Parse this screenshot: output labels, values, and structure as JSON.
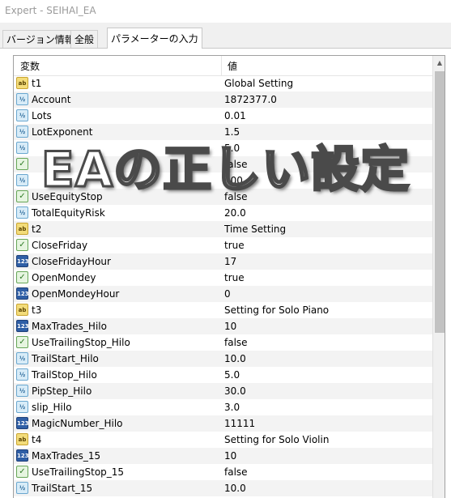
{
  "window": {
    "title": "Expert - SEIHAI_EA"
  },
  "tabs": [
    {
      "label": "バージョン情報"
    },
    {
      "label": "全般"
    },
    {
      "label": "パラメーターの入力",
      "active": true
    }
  ],
  "grid": {
    "col_name": "変数",
    "col_value": "値",
    "rows": [
      {
        "type": "ab",
        "name": "t1",
        "value": "Global Setting"
      },
      {
        "type": "dbl",
        "name": "Account",
        "value": "1872377.0"
      },
      {
        "type": "dbl",
        "name": "Lots",
        "value": "0.01"
      },
      {
        "type": "dbl",
        "name": "LotExponent",
        "value": "1.5"
      },
      {
        "type": "dbl",
        "name": "",
        "value": "5.0"
      },
      {
        "type": "bool",
        "name": "",
        "value": "false"
      },
      {
        "type": "dbl",
        "name": "",
        "value": "100"
      },
      {
        "type": "bool",
        "name": "UseEquityStop",
        "value": "false"
      },
      {
        "type": "dbl",
        "name": "TotalEquityRisk",
        "value": "20.0"
      },
      {
        "type": "ab",
        "name": "t2",
        "value": "Time Setting"
      },
      {
        "type": "bool",
        "name": "CloseFriday",
        "value": "true"
      },
      {
        "type": "int",
        "name": "CloseFridayHour",
        "value": "17"
      },
      {
        "type": "bool",
        "name": "OpenMondey",
        "value": "true"
      },
      {
        "type": "int",
        "name": "OpenMondeyHour",
        "value": "0"
      },
      {
        "type": "ab",
        "name": "t3",
        "value": "Setting for Solo Piano"
      },
      {
        "type": "int",
        "name": "MaxTrades_Hilo",
        "value": "10"
      },
      {
        "type": "bool",
        "name": "UseTrailingStop_Hilo",
        "value": "false"
      },
      {
        "type": "dbl",
        "name": "TrailStart_Hilo",
        "value": "10.0"
      },
      {
        "type": "dbl",
        "name": "TrailStop_Hilo",
        "value": "5.0"
      },
      {
        "type": "dbl",
        "name": "PipStep_Hilo",
        "value": "30.0"
      },
      {
        "type": "dbl",
        "name": "slip_Hilo",
        "value": "3.0"
      },
      {
        "type": "int",
        "name": "MagicNumber_Hilo",
        "value": "11111"
      },
      {
        "type": "ab",
        "name": "t4",
        "value": "Setting for Solo Violin"
      },
      {
        "type": "int",
        "name": "MaxTrades_15",
        "value": "10"
      },
      {
        "type": "bool",
        "name": "UseTrailingStop_15",
        "value": "false"
      },
      {
        "type": "dbl",
        "name": "TrailStart_15",
        "value": "10.0"
      }
    ]
  },
  "icons": {
    "ab": {
      "glyph": "ab",
      "name": "string-type-icon"
    },
    "dbl": {
      "glyph": "½",
      "name": "double-type-icon"
    },
    "int": {
      "glyph": "123",
      "name": "integer-type-icon"
    },
    "bool": {
      "glyph": "✓",
      "name": "bool-type-icon"
    }
  },
  "overlay": {
    "text": "EAの正しい設定"
  }
}
